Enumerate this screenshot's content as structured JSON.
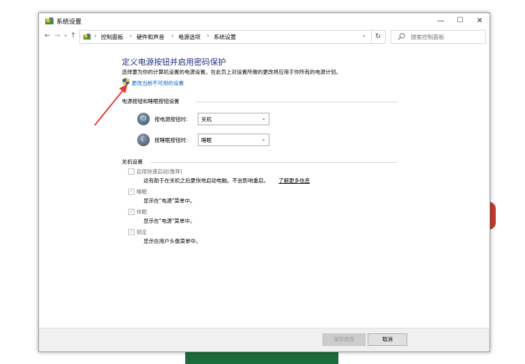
{
  "window": {
    "title": "系统设置",
    "controls": {
      "minimize": "—",
      "maximize": "☐",
      "close": "✕"
    }
  },
  "address": {
    "back": "←",
    "forward": "→",
    "recent": "⌄",
    "up": "↑",
    "breadcrumbs": [
      "控制面板",
      "硬件和声音",
      "电源选项",
      "系统设置"
    ],
    "separator": "›",
    "dropdown": "⌄",
    "refresh": "↻",
    "search_placeholder": "搜索控制面板"
  },
  "main": {
    "heading": "定义电源按钮并启用密码保护",
    "description": "选择要为你的计算机设置的电源设置。在此页上对设置所做的更改将应用于你所有的电源计划。",
    "change_link": "更改当前不可用的设置",
    "power_section": {
      "title": "电源按钮和睡眠按钮设置",
      "power_button": {
        "label": "按电源按钮时:",
        "value": "关机"
      },
      "sleep_button": {
        "label": "按睡眠按钮时:",
        "value": "睡眠"
      }
    },
    "shutdown_section": {
      "title": "关机设置",
      "options": [
        {
          "label": "启用快速启动(推荐)",
          "checked": false,
          "desc": "这有助于在关机之后更快地启动电脑。不会影响重启。",
          "link": "了解更多信息"
        },
        {
          "label": "睡眠",
          "checked": true,
          "desc": "显示在\"电源\"菜单中。"
        },
        {
          "label": "休眠",
          "checked": true,
          "desc": "显示在\"电源\"菜单中。"
        },
        {
          "label": "锁定",
          "checked": true,
          "desc": "显示在用户头像菜单中。"
        }
      ]
    }
  },
  "footer": {
    "save": "保存修改",
    "cancel": "取消"
  },
  "colors": {
    "heading": "#1e3287",
    "link": "#0066cc",
    "annotation_arrow": "#e8382e"
  }
}
